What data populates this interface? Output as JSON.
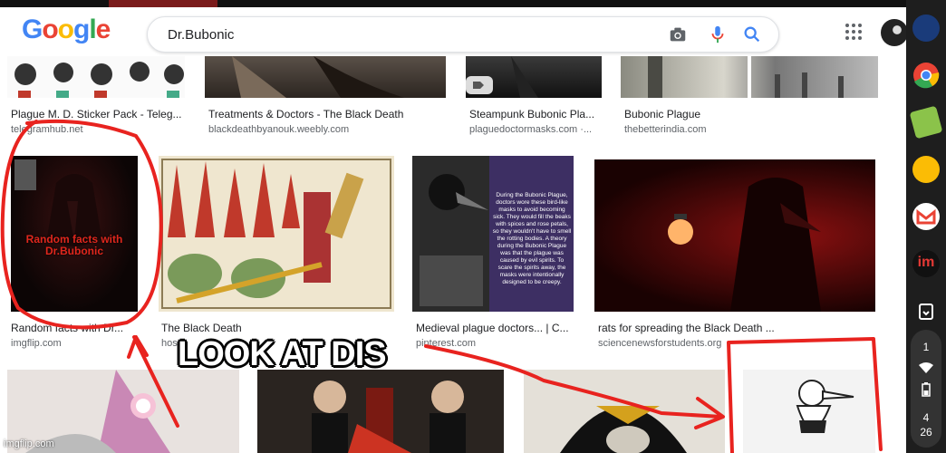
{
  "search": {
    "query": "Dr.Bubonic"
  },
  "logo_text": "Google",
  "results_row1": [
    {
      "title": "Plague M. D. Sticker Pack - Teleg...",
      "source": "telegramhub.net"
    },
    {
      "title": "Treatments & Doctors - The Black Death",
      "source": "blackdeathbyanouk.weebly.com"
    },
    {
      "title": "Steampunk Bubonic Pla...",
      "source": "plaguedoctormasks.com ·..."
    },
    {
      "title": "Bubonic Plague",
      "source": "thebetterindia.com"
    }
  ],
  "results_row2": [
    {
      "title": "Random facts with Dr...",
      "source": "imgflip.com",
      "thumb_text": "Random facts with Dr.Bubonic"
    },
    {
      "title": "The Black Death",
      "source": "hos..."
    },
    {
      "title": "Medieval plague doctors... | C...",
      "source": "pinterest.com",
      "thumb_text": "During the Bubonic Plague, doctors wore these bird-like masks to avoid becoming sick. They would fill the beaks with spices and rose petals, so they wouldn't have to smell the rotting bodies. A theory during the Bubonic Plague was that the plague was caused by evil spirits. To scare the spirits away, the masks were intentionally designed to be creepy."
    },
    {
      "title": "rats for spreading the Black Death ...",
      "source": "sciencenewsforstudents.org"
    }
  ],
  "meme": {
    "caption": "LOOK AT DIS",
    "watermark": "imgflip.com"
  },
  "shelf": {
    "notification_count": "1",
    "time_hour": "4",
    "time_min": "26"
  },
  "colors": {
    "annotation_red": "#e8231f",
    "google_blue": "#4285f4",
    "google_red": "#ea4335",
    "google_yellow": "#fbbc05",
    "google_green": "#34a853"
  }
}
